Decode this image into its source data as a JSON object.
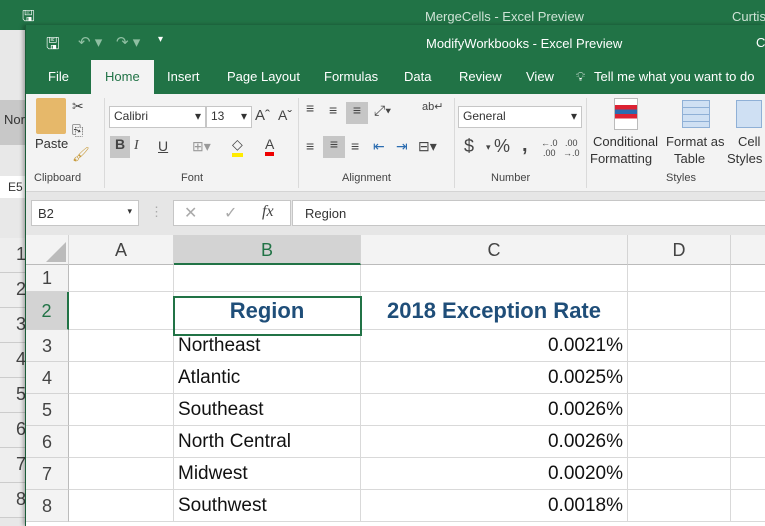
{
  "back_window": {
    "title": "MergeCells  -  Excel Preview",
    "user": "Curtis",
    "name_box": "E5",
    "style_label": "Nor",
    "rows": [
      "1",
      "2",
      "3",
      "4",
      "5",
      "6",
      "7",
      "8"
    ]
  },
  "window": {
    "title": "ModifyWorkbooks  -  Excel Preview",
    "user": "C"
  },
  "tabs": [
    "File",
    "Home",
    "Insert",
    "Page Layout",
    "Formulas",
    "Data",
    "Review",
    "View"
  ],
  "tell_me": "Tell me what you want to do",
  "ribbon": {
    "clipboard": {
      "paste": "Paste",
      "label": "Clipboard"
    },
    "font": {
      "name": "Calibri",
      "size": "13",
      "label": "Font",
      "bold": "B",
      "italic": "I",
      "underline": "U"
    },
    "alignment": {
      "label": "Alignment"
    },
    "number": {
      "format": "General",
      "label": "Number",
      "currency": "$",
      "percent": "%",
      "comma": ","
    },
    "styles": {
      "conditional": "Conditional",
      "formatting": "Formatting",
      "format_as": "Format as",
      "table": "Table",
      "cell": "Cell",
      "cell_styles": "Styles",
      "label": "Styles"
    }
  },
  "formula_bar": {
    "name_box": "B2",
    "fx": "fx",
    "value": "Region"
  },
  "columns": [
    "A",
    "B",
    "C",
    "D"
  ],
  "rows": [
    {
      "num": "1",
      "b": "",
      "c": ""
    },
    {
      "num": "2",
      "b": "Region",
      "c": "2018 Exception Rate"
    },
    {
      "num": "3",
      "b": "Northeast",
      "c": "0.0021%"
    },
    {
      "num": "4",
      "b": "Atlantic",
      "c": "0.0025%"
    },
    {
      "num": "5",
      "b": "Southeast",
      "c": "0.0026%"
    },
    {
      "num": "6",
      "b": "North Central",
      "c": "0.0026%"
    },
    {
      "num": "7",
      "b": "Midwest",
      "c": "0.0020%"
    },
    {
      "num": "8",
      "b": "Southwest",
      "c": "0.0018%"
    }
  ],
  "colors": {
    "accent": "#217346",
    "header_text": "#1f4e79"
  }
}
